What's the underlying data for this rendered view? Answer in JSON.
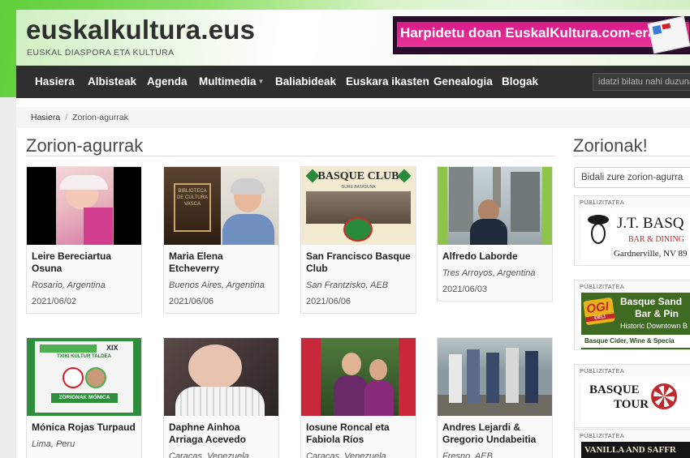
{
  "site": {
    "title": "euskalkultura.eus",
    "subtitle": "EUSKAL DIASPORA ETA KULTURA",
    "banner_text": "Harpidetu doan EuskalKultura.com-era!"
  },
  "nav": {
    "items": [
      "Hasiera",
      "Albisteak",
      "Agenda",
      "Multimedia",
      "Baliabideak",
      "Euskara ikasten",
      "Genealogia",
      "Blogak"
    ],
    "search_placeholder": "idatzi bilatu nahi duzuna"
  },
  "breadcrumb": {
    "home": "Hasiera",
    "current": "Zorion-agurrak"
  },
  "main": {
    "heading": "Zorion-agurrak",
    "cards": [
      {
        "name": "Leire Bereciartua Osuna",
        "place": "Rosario, Argentina",
        "date": "2021/06/02"
      },
      {
        "name": "Maria Elena Etcheverry",
        "place": "Buenos Aires, Argentina",
        "date": "2021/06/06"
      },
      {
        "name": "San Francisco Basque Club",
        "place": "San Frantzisko, AEB",
        "date": "2021/06/06"
      },
      {
        "name": "Alfredo Laborde",
        "place": "Tres Arroyos, Argentina",
        "date": "2021/06/03"
      },
      {
        "name": "Mónica Rojas Turpaud",
        "place": "Lima, Peru",
        "date": ""
      },
      {
        "name": "Daphne Ainhoa Arriaga Acevedo",
        "place": "Caracas, Venezuela",
        "date": ""
      },
      {
        "name": "Iosune Roncal eta Fabiola Ríos",
        "place": "Caracas, Venezuela",
        "date": ""
      },
      {
        "name": "Andres Lejardi & Gregorio Undabeitia",
        "place": "Fresno, AEB",
        "date": ""
      }
    ],
    "thumbs": {
      "basque_club_title": "BASQUE CLUB",
      "basque_club_sub": "GURE BATASUNA",
      "biblioteca_text": "BIBLIOTECA DE CULTURA VASCA",
      "monica_banner": "ZORIONAK MÓNICA",
      "monica_top": "TXIKI KULTUR TALDEA",
      "monica_num": "XIX"
    }
  },
  "sidebar": {
    "heading": "Zorionak!",
    "select_label": "Bidali zure zorion-agurra",
    "ad_label": "PUBLIZITATEA",
    "ads": [
      {
        "title": "J.T. BASQ",
        "line2": "BAR & DINING",
        "line3": "Gardnerville, NV 89"
      },
      {
        "logo": "OGI",
        "logo_sub": "DELI",
        "title": "Basque Sand",
        "line2": "Bar & Pin",
        "line3": "Historic Downtown B",
        "line4": "Basque Cider, Wine & Specia"
      },
      {
        "title": "BASQUE",
        "line2": "TOUR"
      },
      {
        "title": "VANILLA AND SAFFR"
      }
    ]
  },
  "colors": {
    "nav_bg": "#2f2f2f",
    "banner_pink": "#e0288f",
    "accent_green": "#5fcf3a"
  }
}
